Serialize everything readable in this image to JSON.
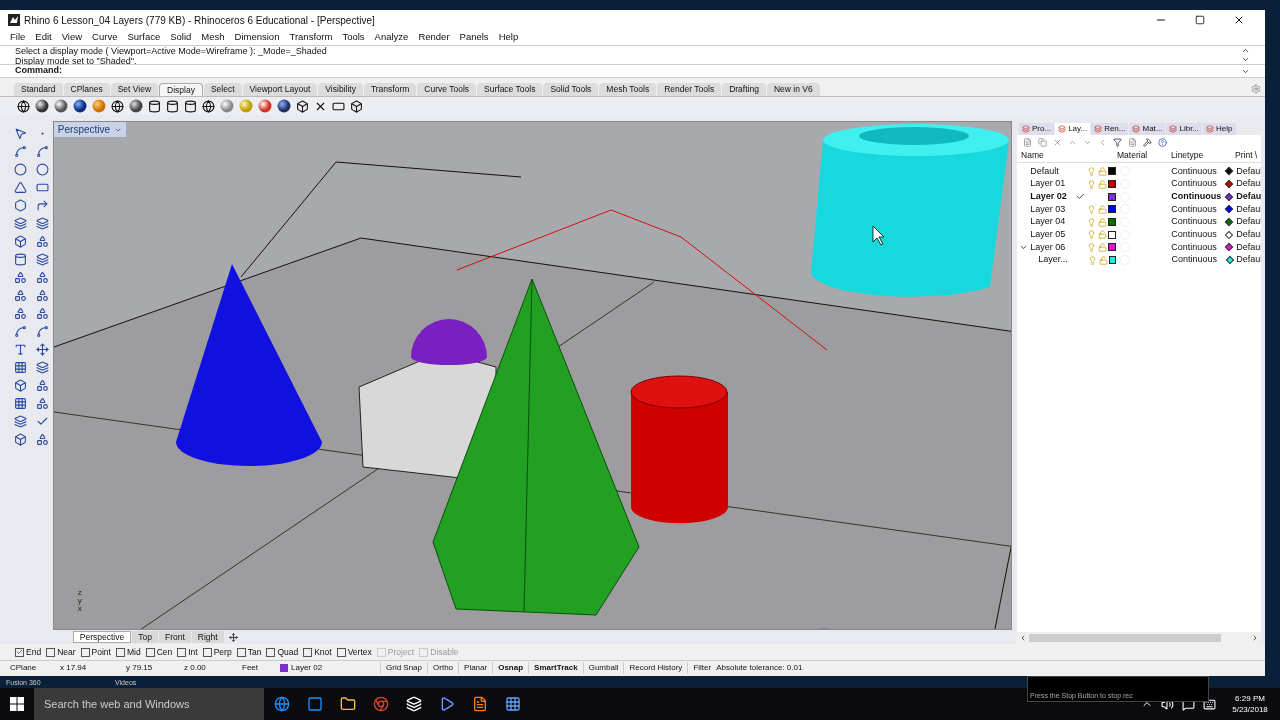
{
  "window": {
    "title": "Rhino 6 Lesson_04 Layers (779 KB) - Rhinoceros 6 Educational - [Perspective]"
  },
  "menu": [
    "File",
    "Edit",
    "View",
    "Curve",
    "Surface",
    "Solid",
    "Mesh",
    "Dimension",
    "Transform",
    "Tools",
    "Analyze",
    "Render",
    "Panels",
    "Help"
  ],
  "command": {
    "history": [
      "Select a display mode ( Viewport=Active  Mode=Wireframe ): _Mode=_Shaded",
      "Display mode set to \"Shaded\"."
    ],
    "prompt": "Command:"
  },
  "toolbar_tabs": [
    {
      "label": "Standard",
      "selected": false
    },
    {
      "label": "CPlanes",
      "selected": false
    },
    {
      "label": "Set View",
      "selected": false
    },
    {
      "label": "Display",
      "selected": true
    },
    {
      "label": "Select",
      "selected": false
    },
    {
      "label": "Viewport Layout",
      "selected": false
    },
    {
      "label": "Visibility",
      "selected": false
    },
    {
      "label": "Transform",
      "selected": false
    },
    {
      "label": "Curve Tools",
      "selected": false
    },
    {
      "label": "Surface Tools",
      "selected": false
    },
    {
      "label": "Solid Tools",
      "selected": false
    },
    {
      "label": "Mesh Tools",
      "selected": false
    },
    {
      "label": "Render Tools",
      "selected": false
    },
    {
      "label": "Drafting",
      "selected": false
    },
    {
      "label": "New in V6",
      "selected": false
    }
  ],
  "viewport": {
    "label": "Perspective",
    "axis_labels": [
      "z",
      "y",
      "x"
    ]
  },
  "viewport_tabs": [
    {
      "label": "Perspective",
      "selected": true
    },
    {
      "label": "Top",
      "selected": false
    },
    {
      "label": "Front",
      "selected": false
    },
    {
      "label": "Right",
      "selected": false
    }
  ],
  "panel_tabs": [
    {
      "label": "Pro...",
      "selected": false
    },
    {
      "label": "Lay...",
      "selected": true
    },
    {
      "label": "Ren...",
      "selected": false
    },
    {
      "label": "Mat...",
      "selected": false
    },
    {
      "label": "Libr...",
      "selected": false
    },
    {
      "label": "Help",
      "selected": false
    }
  ],
  "layers": {
    "columns": [
      "Name",
      "Material",
      "Linetype",
      "Print \\"
    ],
    "rows": [
      {
        "name": "Default",
        "current": false,
        "color": "#000000",
        "linetype": "Continuous",
        "print": "Defaul"
      },
      {
        "name": "Layer 01",
        "current": false,
        "color": "#c00000",
        "linetype": "Continuous",
        "print": "Defaul"
      },
      {
        "name": "Layer 02",
        "current": true,
        "color": "#7b2fc9",
        "linetype": "Continuous",
        "print": "Defau"
      },
      {
        "name": "Layer 03",
        "current": false,
        "color": "#0000ff",
        "linetype": "Continuous",
        "print": "Defaul"
      },
      {
        "name": "Layer 04",
        "current": false,
        "color": "#007000",
        "linetype": "Continuous",
        "print": "Defaul"
      },
      {
        "name": "Layer 05",
        "current": false,
        "color": "#ffffff",
        "linetype": "Continuous",
        "print": "Defaul"
      },
      {
        "name": "Layer 06",
        "current": false,
        "color": "#e010d0",
        "linetype": "Continuous",
        "print": "Defaul",
        "expanded": true,
        "children": [
          {
            "name": "Layer...",
            "current": false,
            "color": "#20e8e8",
            "linetype": "Continuous",
            "print": "Defaul"
          }
        ]
      }
    ]
  },
  "osnaps": [
    {
      "label": "End",
      "checked": true,
      "disabled": false
    },
    {
      "label": "Near",
      "checked": false,
      "disabled": false
    },
    {
      "label": "Point",
      "checked": false,
      "disabled": false
    },
    {
      "label": "Mid",
      "checked": false,
      "disabled": false
    },
    {
      "label": "Cen",
      "checked": false,
      "disabled": false
    },
    {
      "label": "Int",
      "checked": false,
      "disabled": false
    },
    {
      "label": "Perp",
      "checked": false,
      "disabled": false
    },
    {
      "label": "Tan",
      "checked": false,
      "disabled": false
    },
    {
      "label": "Quad",
      "checked": false,
      "disabled": false
    },
    {
      "label": "Knot",
      "checked": false,
      "disabled": false
    },
    {
      "label": "Vertex",
      "checked": false,
      "disabled": false
    },
    {
      "label": "Project",
      "checked": false,
      "disabled": true
    },
    {
      "label": "Disable",
      "checked": false,
      "disabled": true
    }
  ],
  "status_bar": {
    "cells": [
      "CPlane",
      "x 17.94",
      "y 79.15",
      "z 0.00",
      "Feet"
    ],
    "layer": {
      "name": "Layer 02",
      "color": "#7b2fc9"
    },
    "toggles": [
      {
        "label": "Grid Snap",
        "on": false
      },
      {
        "label": "Ortho",
        "on": false
      },
      {
        "label": "Planar",
        "on": false
      },
      {
        "label": "Osnap",
        "on": true
      },
      {
        "label": "SmartTrack",
        "on": true
      },
      {
        "label": "Gumball",
        "on": false
      },
      {
        "label": "Record History",
        "on": false
      },
      {
        "label": "Filter",
        "on": false
      }
    ],
    "tolerance": "Absolute tolerance: 0.01"
  },
  "desktop_labels": [
    "Fusion 360",
    "Videos"
  ],
  "recorder_hint": "Press the Stop Button to stop rec",
  "taskbar": {
    "search_placeholder": "Search the web and Windows",
    "time": "6:29 PM",
    "date": "5/23/2018"
  }
}
